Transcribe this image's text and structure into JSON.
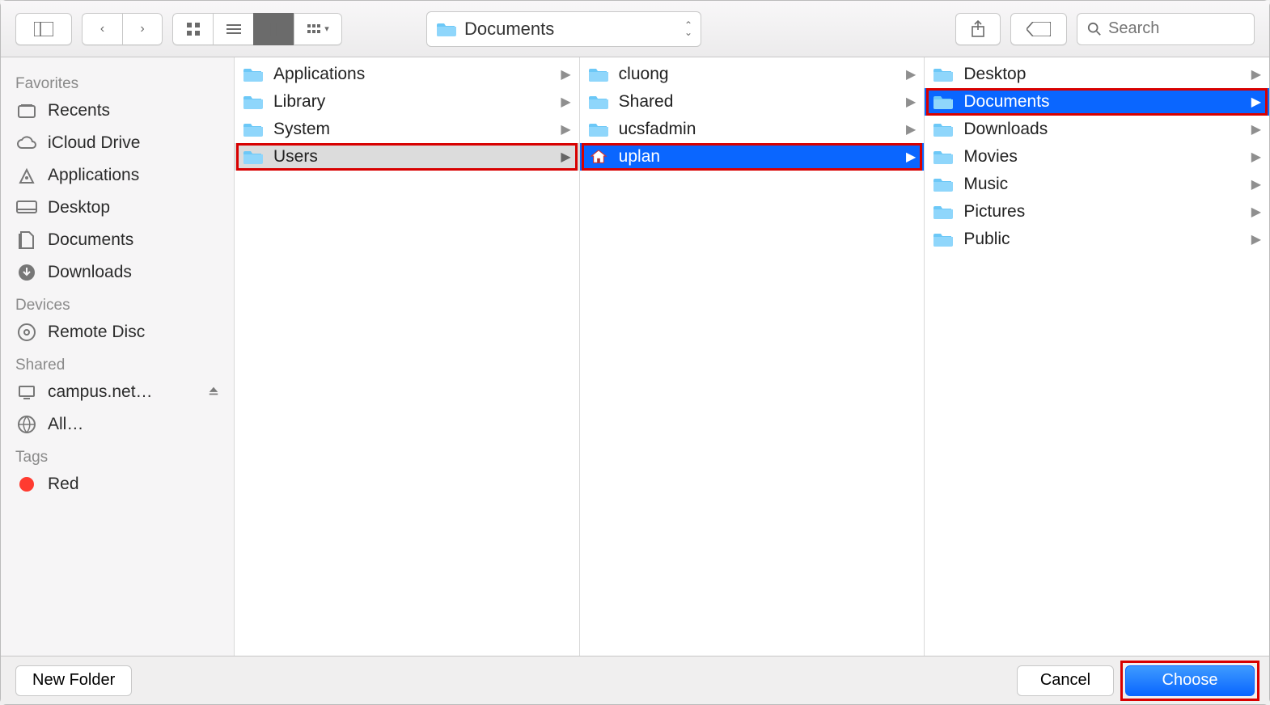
{
  "toolbar": {
    "current_location": "Documents",
    "search_placeholder": "Search"
  },
  "sidebar": {
    "sections": [
      {
        "title": "Favorites",
        "items": [
          {
            "icon": "recents-icon",
            "label": "Recents"
          },
          {
            "icon": "icloud-icon",
            "label": "iCloud Drive"
          },
          {
            "icon": "applications-icon",
            "label": "Applications"
          },
          {
            "icon": "desktop-icon",
            "label": "Desktop"
          },
          {
            "icon": "documents-icon",
            "label": "Documents"
          },
          {
            "icon": "downloads-icon",
            "label": "Downloads"
          }
        ]
      },
      {
        "title": "Devices",
        "items": [
          {
            "icon": "disc-icon",
            "label": "Remote Disc"
          }
        ]
      },
      {
        "title": "Shared",
        "items": [
          {
            "icon": "server-icon",
            "label": "campus.net…",
            "eject": true
          },
          {
            "icon": "network-icon",
            "label": "All…"
          }
        ]
      },
      {
        "title": "Tags",
        "items": [
          {
            "icon": "tag-dot",
            "label": "Red",
            "color": "#ff3b30"
          }
        ]
      }
    ]
  },
  "columns": [
    {
      "items": [
        {
          "icon": "folder-app",
          "label": "Applications",
          "state": "normal"
        },
        {
          "icon": "folder-lib",
          "label": "Library",
          "state": "normal"
        },
        {
          "icon": "folder-sys",
          "label": "System",
          "state": "normal"
        },
        {
          "icon": "folder-users",
          "label": "Users",
          "state": "path",
          "highlight": true
        }
      ]
    },
    {
      "items": [
        {
          "icon": "folder",
          "label": "cluong",
          "state": "normal"
        },
        {
          "icon": "folder",
          "label": "Shared",
          "state": "normal"
        },
        {
          "icon": "folder",
          "label": "ucsfadmin",
          "state": "normal"
        },
        {
          "icon": "home",
          "label": "uplan",
          "state": "selected",
          "highlight": true
        }
      ]
    },
    {
      "items": [
        {
          "icon": "folder-desk",
          "label": "Desktop",
          "state": "normal"
        },
        {
          "icon": "folder-docs",
          "label": "Documents",
          "state": "selected",
          "highlight": true
        },
        {
          "icon": "folder-dl",
          "label": "Downloads",
          "state": "normal"
        },
        {
          "icon": "folder-mov",
          "label": "Movies",
          "state": "normal"
        },
        {
          "icon": "folder-mus",
          "label": "Music",
          "state": "normal"
        },
        {
          "icon": "folder-pic",
          "label": "Pictures",
          "state": "normal"
        },
        {
          "icon": "folder",
          "label": "Public",
          "state": "normal"
        }
      ]
    }
  ],
  "footer": {
    "new_folder_label": "New Folder",
    "cancel_label": "Cancel",
    "choose_label": "Choose"
  }
}
